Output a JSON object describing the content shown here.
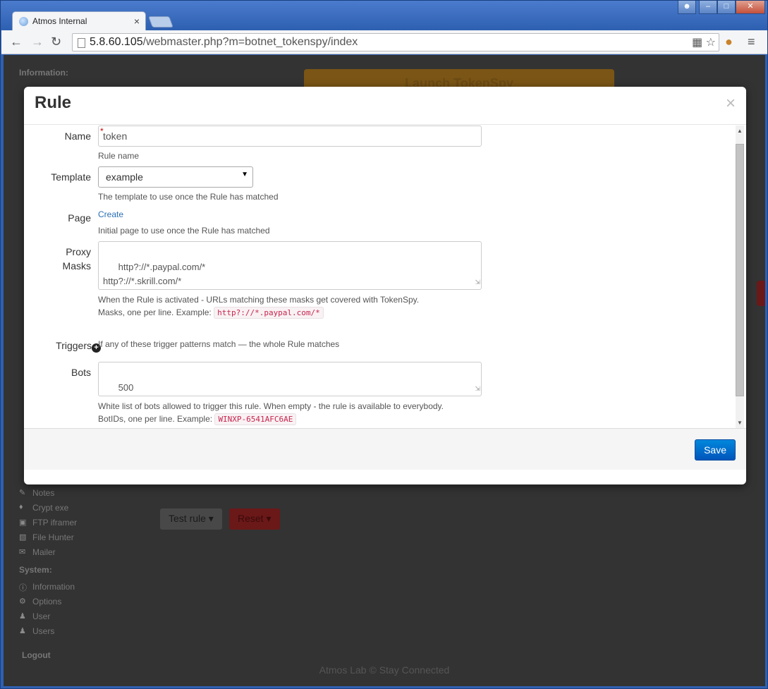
{
  "browser": {
    "tab_title": "Atmos Internal",
    "tab_close": "×",
    "url_host": "5.8.60.105",
    "url_path": "/webmaster.php?m=botnet_tokenspy/index"
  },
  "page": {
    "launch_button": "Launch TokenSpy",
    "sidebar": {
      "information_heading": "Information:",
      "system_heading": "System:",
      "tools": [
        "Notes",
        "Crypt exe",
        "FTP iframer",
        "File Hunter",
        "Mailer"
      ],
      "system_items": [
        "Information",
        "Options",
        "User",
        "Users"
      ],
      "logout": "Logout"
    },
    "test_rule_button": "Test rule ▾",
    "reset_button": "Reset ▾",
    "footer": "Atmos Lab © Stay Connected"
  },
  "modal": {
    "title": "Rule",
    "close": "×",
    "name": {
      "label": "Name",
      "value": "token",
      "required_mark": "*",
      "help": "Rule name"
    },
    "template": {
      "label": "Template",
      "value": "example",
      "help": "The template to use once the Rule has matched"
    },
    "page": {
      "label": "Page",
      "link": "Create",
      "help": "Initial page to use once the Rule has matched"
    },
    "proxy_masks": {
      "label_line1": "Proxy",
      "label_line2": "Masks",
      "value": "http?://*.paypal.com/*\nhttp?://*.skrill.com/*",
      "help1": "When the Rule is activated - URLs matching these masks get covered with TokenSpy.",
      "help2": "Masks, one per line. Example:",
      "example": "http?://*.paypal.com/*"
    },
    "triggers": {
      "label": "Triggers",
      "help": "If any of these trigger patterns match — the whole Rule matches"
    },
    "bots": {
      "label": "Bots",
      "value": "500",
      "help1": "White list of bots allowed to trigger this rule. When empty - the rule is available to everybody.",
      "help2": "BotIDs, one per line. Example:",
      "example": "WINXP-6541AFC6AE"
    },
    "save_button": "Save"
  }
}
